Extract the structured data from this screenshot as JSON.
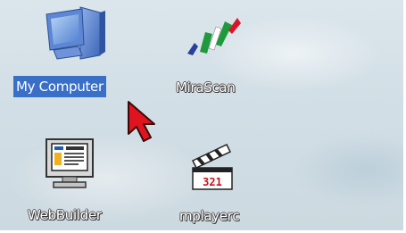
{
  "desktop": {
    "icons": [
      {
        "label": "My Computer",
        "icon": "my-computer-icon",
        "selected": true
      },
      {
        "label": "MiraScan",
        "icon": "mirascan-icon",
        "selected": false
      },
      {
        "label": "WebBuilder",
        "icon": "webbuilder-icon",
        "selected": false
      },
      {
        "label": "mplayerc",
        "icon": "mplayerc-icon",
        "selected": false
      }
    ],
    "clapper_text": "321",
    "selection_color": "#3a6fc8",
    "cursor": "arrow-cursor-icon",
    "cursor_color": "#e0141e"
  }
}
